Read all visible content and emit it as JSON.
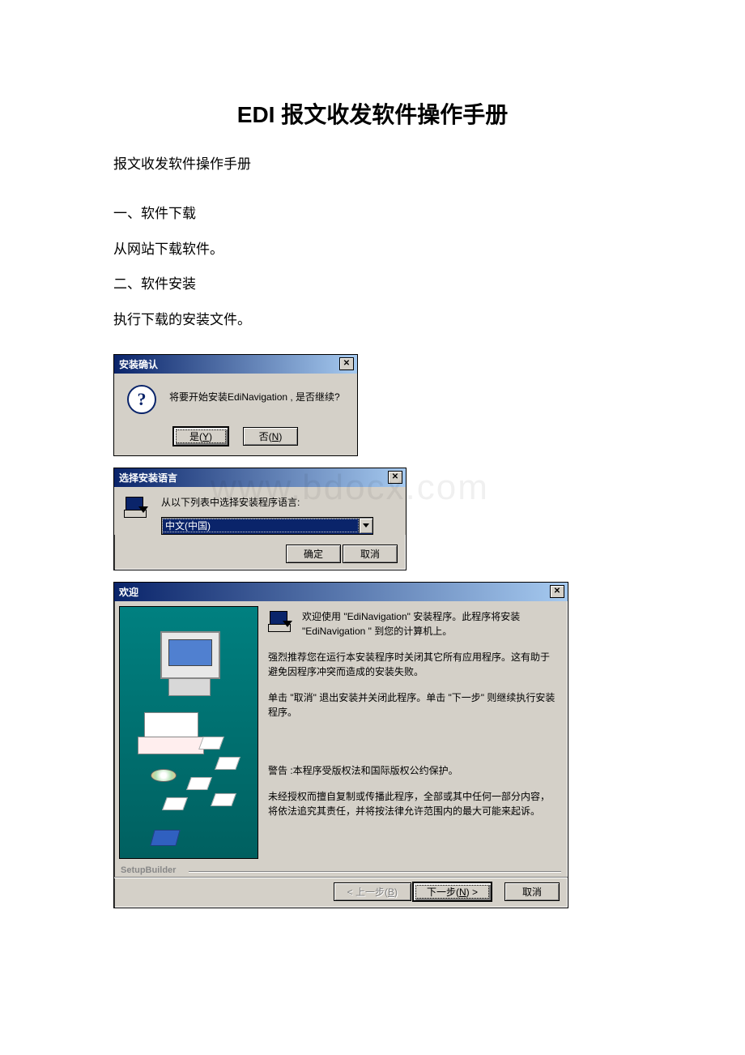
{
  "title": "EDI 报文收发软件操作手册",
  "intro": "报文收发软件操作手册",
  "sec1_heading": "一、软件下载",
  "sec1_text": "从网站下载软件。",
  "sec2_heading": "二、软件安装",
  "sec2_text": "执行下载的安装文件。",
  "watermark": "www.bdocx.com",
  "dialog_confirm": {
    "title": "安装确认",
    "message": "将要开始安装EdiNavigation , 是否继续?",
    "yes_label_pre": "是(",
    "yes_key": "Y",
    "yes_label_post": ")",
    "no_label_pre": "否(",
    "no_key": "N",
    "no_label_post": ")"
  },
  "dialog_lang": {
    "title": "选择安装语言",
    "prompt": "从以下列表中选择安装程序语言:",
    "selected": "中文(中国)",
    "ok": "确定",
    "cancel": "取消"
  },
  "dialog_welcome": {
    "title": "欢迎",
    "line1": "欢迎使用 \"EdiNavigation\" 安装程序。此程序将安装 \"EdiNavigation \" 到您的计算机上。",
    "line2": "强烈推荐您在运行本安装程序时关闭其它所有应用程序。这有助于避免因程序冲突而造成的安装失败。",
    "line3": "单击 \"取消\" 退出安装并关闭此程序。单击 \"下一步\" 则继续执行安装程序。",
    "warn_label": "警告 :",
    "warn_text": "本程序受版权法和国际版权公约保护。",
    "line5": "未经授权而擅自复制或传播此程序，全部或其中任何一部分内容，将依法追究其责任，并将按法律允许范围内的最大可能来起诉。",
    "setupbuilder": "SetupBuilder",
    "back_pre": "< 上一步(",
    "back_key": "B",
    "back_post": ")",
    "next_pre": "下一步(",
    "next_key": "N",
    "next_post": ") >",
    "cancel": "取消"
  }
}
